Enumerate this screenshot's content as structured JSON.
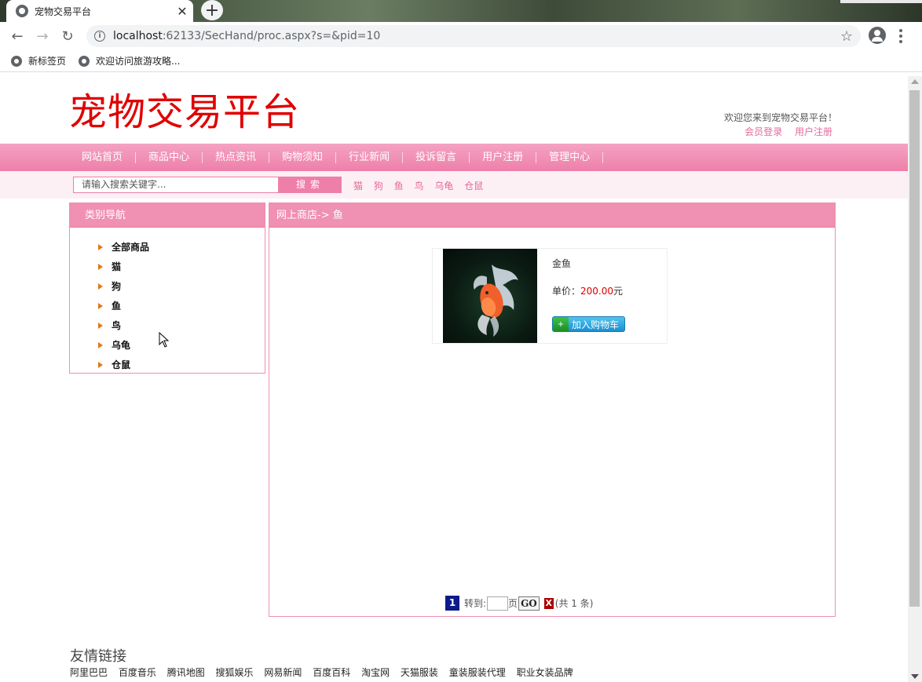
{
  "browser": {
    "tab_title": "宠物交易平台",
    "tab_close": "✕",
    "new_tab": "+",
    "url_host": "localhost",
    "url_rest": ":62133/SecHand/proc.aspx?s=&pid=10",
    "bookmarks": [
      "新标签页",
      "欢迎访问旅游攻略..."
    ]
  },
  "header": {
    "logo": "宠物交易平台",
    "welcome": "欢迎您来到宠物交易平台！",
    "login": "会员登录",
    "register": "用户注册"
  },
  "nav": {
    "items": [
      "网站首页",
      "商品中心",
      "热点资讯",
      "购物须知",
      "行业新闻",
      "投诉留言",
      "用户注册",
      "管理中心"
    ]
  },
  "search": {
    "placeholder": "请输入搜索关键字...",
    "button": "搜索",
    "hotwords": [
      "猫",
      "狗",
      "鱼",
      "鸟",
      "乌龟",
      "仓鼠"
    ]
  },
  "categories": {
    "title": "类别导航",
    "items": [
      "全部商品",
      "猫",
      "狗",
      "鱼",
      "鸟",
      "乌龟",
      "仓鼠"
    ]
  },
  "shop": {
    "title": "网上商店-> 鱼",
    "product": {
      "name": "金鱼",
      "price_label": "单价：",
      "price": "200.00",
      "currency": "元",
      "cart_button": "加入购物车"
    },
    "pager": {
      "current": "1",
      "goto_label": "转到:",
      "page_label": "页",
      "go": "GO",
      "close": "X",
      "total": "(共 1 条)"
    }
  },
  "friends": {
    "title": "友情链接",
    "links": [
      "阿里巴巴",
      "百度音乐",
      "腾讯地图",
      "搜狐娱乐",
      "网易新闻",
      "百度百科",
      "淘宝网",
      "天猫服装",
      "童装服装代理",
      "职业女装品牌"
    ]
  }
}
